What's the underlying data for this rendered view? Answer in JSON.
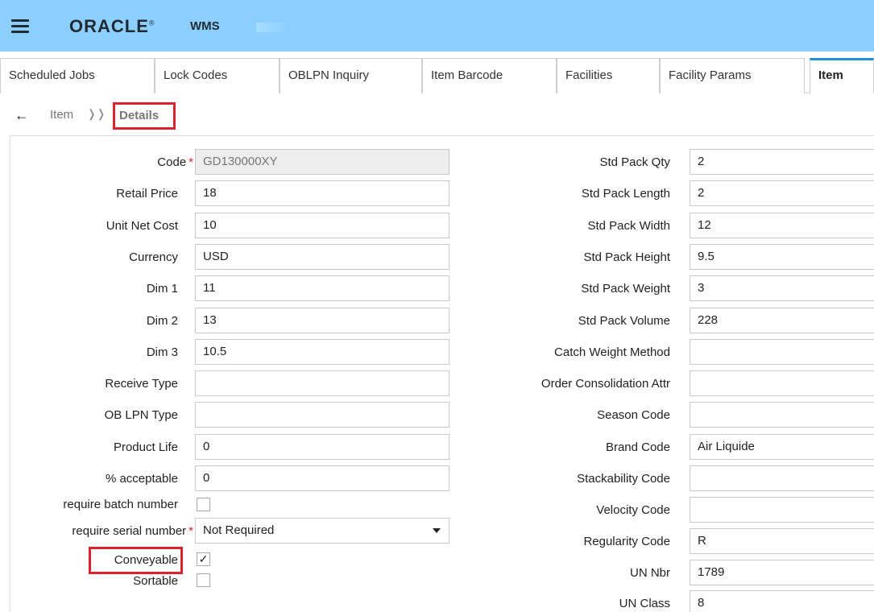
{
  "header": {
    "logo": "ORACLE",
    "logo_mark": "®",
    "app_name": "WMS"
  },
  "tabs": [
    {
      "label": "Scheduled Jobs"
    },
    {
      "label": "Lock Codes"
    },
    {
      "label": "OBLPN Inquiry"
    },
    {
      "label": "Item Barcode"
    },
    {
      "label": "Facilities"
    },
    {
      "label": "Facility Params"
    },
    {
      "label": "Item",
      "active": true
    }
  ],
  "breadcrumb": {
    "parent": "Item",
    "current": "Details"
  },
  "form_left": {
    "code": {
      "label": "Code",
      "value": "GD130000XY"
    },
    "retail_price": {
      "label": "Retail Price",
      "value": "18"
    },
    "unit_net_cost": {
      "label": "Unit Net Cost",
      "value": "10"
    },
    "currency": {
      "label": "Currency",
      "value": "USD"
    },
    "dim1": {
      "label": "Dim 1",
      "value": "11"
    },
    "dim2": {
      "label": "Dim 2",
      "value": "13"
    },
    "dim3": {
      "label": "Dim 3",
      "value": "10.5"
    },
    "receive_type": {
      "label": "Receive Type",
      "value": ""
    },
    "ob_lpn_type": {
      "label": "OB LPN Type",
      "value": ""
    },
    "product_life": {
      "label": "Product Life",
      "value": "0"
    },
    "pct_acceptable": {
      "label": "% acceptable",
      "value": "0"
    },
    "require_batch": {
      "label": "require batch number",
      "checked": false
    },
    "require_serial": {
      "label": "require serial number",
      "value": "Not Required"
    },
    "conveyable": {
      "label": "Conveyable",
      "checked": true
    },
    "sortable": {
      "label": "Sortable",
      "checked": false
    }
  },
  "form_right": {
    "std_pack_qty": {
      "label": "Std Pack Qty",
      "value": "2"
    },
    "std_pack_length": {
      "label": "Std Pack Length",
      "value": "2"
    },
    "std_pack_width": {
      "label": "Std Pack Width",
      "value": "12"
    },
    "std_pack_height": {
      "label": "Std Pack Height",
      "value": "9.5"
    },
    "std_pack_weight": {
      "label": "Std Pack Weight",
      "value": "3"
    },
    "std_pack_volume": {
      "label": "Std Pack Volume",
      "value": "228"
    },
    "catch_weight_method": {
      "label": "Catch Weight Method",
      "value": ""
    },
    "order_consolidation_attr": {
      "label": "Order Consolidation Attr",
      "value": ""
    },
    "season_code": {
      "label": "Season Code",
      "value": ""
    },
    "brand_code": {
      "label": "Brand Code",
      "value": "Air Liquide"
    },
    "stackability_code": {
      "label": "Stackability Code",
      "value": ""
    },
    "velocity_code": {
      "label": "Velocity Code",
      "value": ""
    },
    "regularity_code": {
      "label": "Regularity Code",
      "value": "R"
    },
    "un_nbr": {
      "label": "UN Nbr",
      "value": "1789"
    },
    "un_class": {
      "label": "UN Class",
      "value": "8"
    }
  },
  "symbols": {
    "required": "*",
    "check": "✓"
  },
  "colors": {
    "topbar": "#8ccfff",
    "highlight": "#d9232e",
    "active_tab": "#1d8fd6"
  }
}
